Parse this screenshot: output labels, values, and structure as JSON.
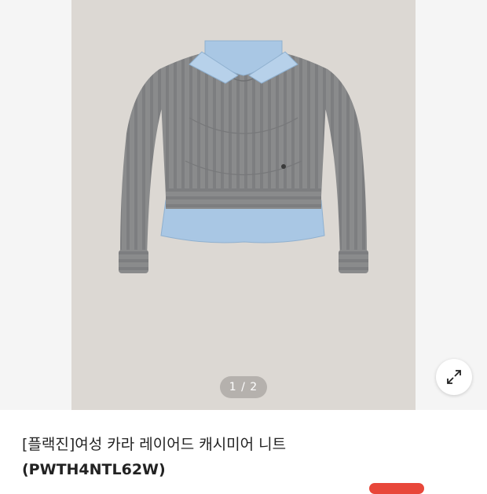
{
  "gallery": {
    "image_alt": "[플랙진]여성 카라 레이어드 캐시미어 니트",
    "counter": "1 / 2",
    "expand_icon": "expand-arrows-icon"
  },
  "product": {
    "title_line1": "[플랙진]여성 카라 레이어드 캐시미어 니트",
    "title_line2": "(PWTH4NTL62W)"
  },
  "colors": {
    "photo_bg": "#dcd8d3",
    "sweater": "#8a8b8c",
    "shirt": "#a9c7e4",
    "accent": "#e8473a"
  }
}
